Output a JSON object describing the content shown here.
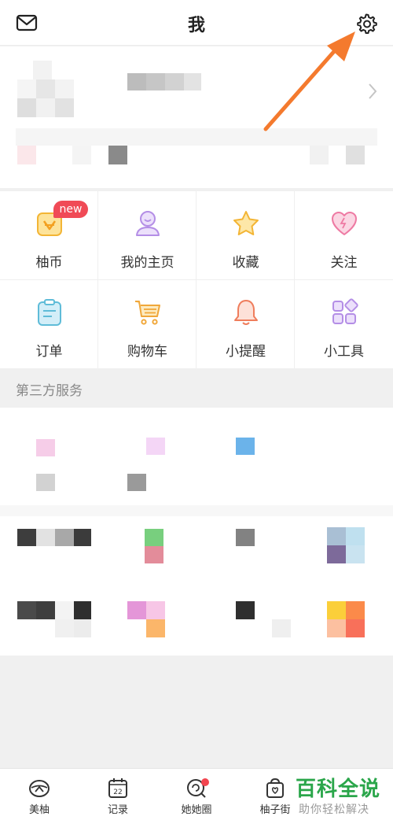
{
  "header": {
    "title": "我"
  },
  "grid": {
    "new_badge": "new",
    "items": [
      {
        "label": "柚币",
        "icon": "coin-icon"
      },
      {
        "label": "我的主页",
        "icon": "user-icon"
      },
      {
        "label": "收藏",
        "icon": "star-icon"
      },
      {
        "label": "关注",
        "icon": "heart-icon"
      },
      {
        "label": "订单",
        "icon": "clipboard-icon"
      },
      {
        "label": "购物车",
        "icon": "cart-icon"
      },
      {
        "label": "小提醒",
        "icon": "bell-icon"
      },
      {
        "label": "小工具",
        "icon": "tools-icon"
      }
    ]
  },
  "services": {
    "title": "第三方服务"
  },
  "tabbar": {
    "tabs": [
      {
        "label": "美柚",
        "icon": "meiyou-icon"
      },
      {
        "label": "记录",
        "icon": "calendar-icon",
        "badge_text": "22"
      },
      {
        "label": "她她圈",
        "icon": "circle-icon"
      },
      {
        "label": "柚子街",
        "icon": "bag-icon"
      }
    ]
  },
  "watermark": {
    "brand": "百科全说",
    "slogan": "助你轻松解决"
  },
  "colors": {
    "accent": "#f04a56",
    "arrow": "#f47a2e",
    "watermark": "#2aa64a"
  }
}
